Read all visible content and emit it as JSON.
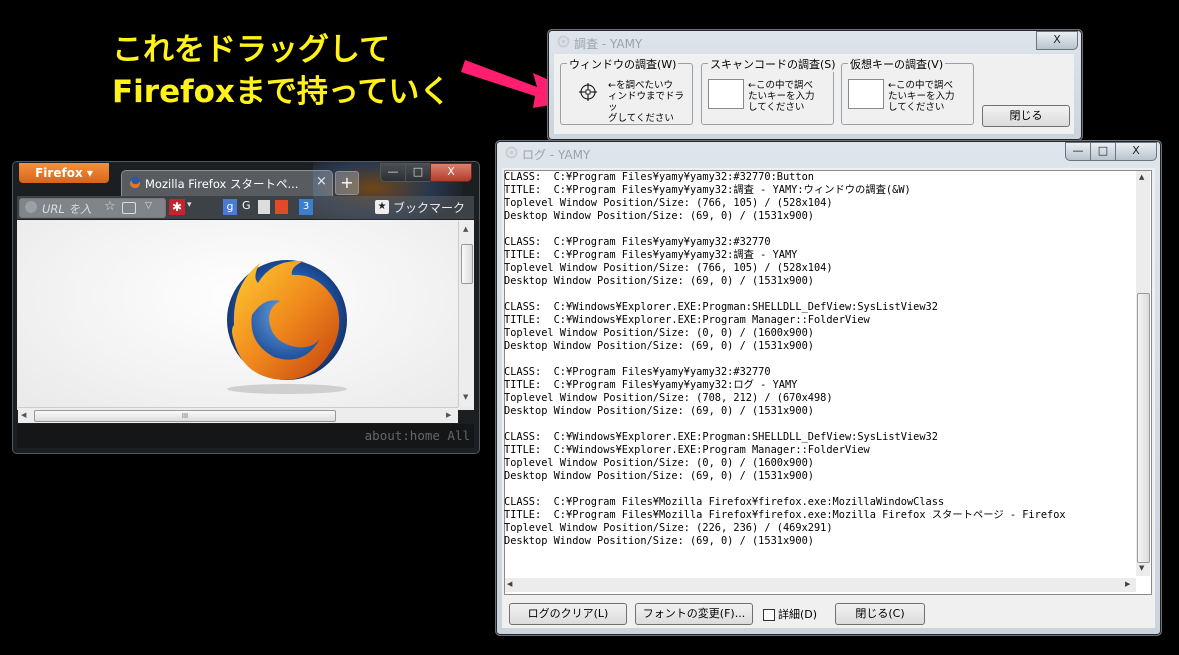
{
  "annotation": {
    "line1": "これをドラッグして",
    "line2": "Firefoxまで持っていく"
  },
  "investigate_window": {
    "title": "調査 - YAMY",
    "close_glyph": "X",
    "window_group": {
      "label": "ウィンドウの調査(W)",
      "help": [
        "←を調べたいウ",
        "ィンドウまでドラッ",
        "グしてください"
      ]
    },
    "scancode_group": {
      "label": "スキャンコードの調査(S)",
      "help": [
        "←この中で調べ",
        "たいキーを入力",
        "してください"
      ]
    },
    "virtualkey_group": {
      "label": "仮想キーの調査(V)",
      "help": [
        "←この中で調べ",
        "たいキーを入力",
        "してください"
      ]
    },
    "close_label": "閉じる"
  },
  "log_window": {
    "title": "ログ - YAMY",
    "min_glyph": "—",
    "max_glyph": "□",
    "close_glyph": "X",
    "lines": [
      "CLASS:  C:¥Program Files¥yamy¥yamy32:#32770:Button",
      "TITLE:  C:¥Program Files¥yamy¥yamy32:調査 - YAMY:ウィンドウの調査(&W)",
      "Toplevel Window Position/Size: (766, 105) / (528x104)",
      "Desktop Window Position/Size: (69, 0) / (1531x900)",
      "",
      "CLASS:  C:¥Program Files¥yamy¥yamy32:#32770",
      "TITLE:  C:¥Program Files¥yamy¥yamy32:調査 - YAMY",
      "Toplevel Window Position/Size: (766, 105) / (528x104)",
      "Desktop Window Position/Size: (69, 0) / (1531x900)",
      "",
      "CLASS:  C:¥Windows¥Explorer.EXE:Progman:SHELLDLL_DefView:SysListView32",
      "TITLE:  C:¥Windows¥Explorer.EXE:Program Manager::FolderView",
      "Toplevel Window Position/Size: (0, 0) / (1600x900)",
      "Desktop Window Position/Size: (69, 0) / (1531x900)",
      "",
      "CLASS:  C:¥Program Files¥yamy¥yamy32:#32770",
      "TITLE:  C:¥Program Files¥yamy¥yamy32:ログ - YAMY",
      "Toplevel Window Position/Size: (708, 212) / (670x498)",
      "Desktop Window Position/Size: (69, 0) / (1531x900)",
      "",
      "CLASS:  C:¥Windows¥Explorer.EXE:Progman:SHELLDLL_DefView:SysListView32",
      "TITLE:  C:¥Windows¥Explorer.EXE:Program Manager::FolderView",
      "Toplevel Window Position/Size: (0, 0) / (1600x900)",
      "Desktop Window Position/Size: (69, 0) / (1531x900)",
      "",
      "CLASS:  C:¥Program Files¥Mozilla Firefox¥firefox.exe:MozillaWindowClass",
      "TITLE:  C:¥Program Files¥Mozilla Firefox¥firefox.exe:Mozilla Firefox スタートページ - Firefox",
      "Toplevel Window Position/Size: (226, 236) / (469x291)",
      "Desktop Window Position/Size: (69, 0) / (1531x900)"
    ],
    "clear_label": "ログのクリア(L)",
    "font_label": "フォントの変更(F)...",
    "detail_label": "詳細(D)",
    "close_label": "閉じる(C)"
  },
  "firefox_window": {
    "menu_button": "Firefox ▾",
    "tab_title": "Mozilla Firefox スタートペ...",
    "tab_close": "×",
    "new_tab": "+",
    "url_placeholder": "URL を入",
    "bookmarks_label": "ブックマーク",
    "status_text": "about:home All",
    "min_glyph": "—",
    "max_glyph": "□",
    "close_glyph": "X",
    "hscroll_grip": "III",
    "icon_labels": [
      "G",
      "3"
    ]
  },
  "colors": {
    "annotation": "#fff21a",
    "arrow": "#ff1f6e",
    "close_red": "#c74b3c"
  }
}
